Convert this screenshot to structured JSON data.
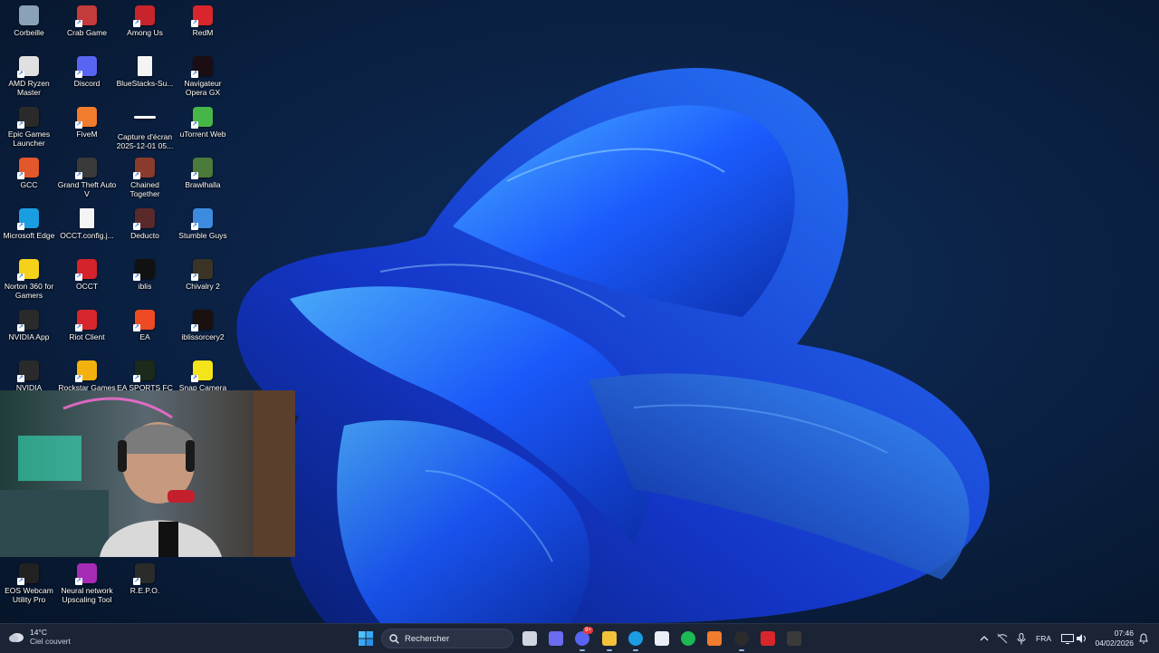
{
  "desktop": {
    "icons": [
      {
        "label": "Corbeille",
        "icon": "recycle-bin-icon",
        "color": "#8aa1b8"
      },
      {
        "label": "Crab Game",
        "icon": "crab-game-icon",
        "color": "#c43b3b"
      },
      {
        "label": "Among Us",
        "icon": "among-us-icon",
        "color": "#c8242c"
      },
      {
        "label": "RedM",
        "icon": "redm-icon",
        "color": "#d8262c"
      },
      {
        "label": "AMD Ryzen\nMaster",
        "icon": "amd-ryzen-icon",
        "color": "#e0e0e0"
      },
      {
        "label": "Discord",
        "icon": "discord-icon",
        "color": "#5865f2"
      },
      {
        "label": "BlueStacks-Su...",
        "icon": "file-icon",
        "color": "#f4f4f4"
      },
      {
        "label": "Navigateur\nOpera GX",
        "icon": "opera-gx-icon",
        "color": "#1a0d14"
      },
      {
        "label": "Epic Games\nLauncher",
        "icon": "epic-games-icon",
        "color": "#2a2a2a"
      },
      {
        "label": "FiveM",
        "icon": "fivem-icon",
        "color": "#f07c2e"
      },
      {
        "label": "Capture d'écran\n2025-12-01 05...",
        "icon": "screenshot-icon",
        "color": "#f4f4f4"
      },
      {
        "label": "uTorrent Web",
        "icon": "utorrent-icon",
        "color": "#47b649"
      },
      {
        "label": "GCC",
        "icon": "gcc-icon",
        "color": "#e2572b"
      },
      {
        "label": "Grand Theft Auto\nV",
        "icon": "gta-v-icon",
        "color": "#3a3a3a"
      },
      {
        "label": "Chained\nTogether",
        "icon": "chained-together-icon",
        "color": "#8a3b2c"
      },
      {
        "label": "Brawlhalla",
        "icon": "brawlhalla-icon",
        "color": "#4b7a3a"
      },
      {
        "label": "Microsoft Edge",
        "icon": "edge-icon",
        "color": "#1b9de2"
      },
      {
        "label": "OCCT.config.j...",
        "icon": "file-icon",
        "color": "#f4f4f4"
      },
      {
        "label": "Deducto",
        "icon": "deducto-icon",
        "color": "#5a2a2a"
      },
      {
        "label": "Stumble Guys",
        "icon": "stumble-guys-icon",
        "color": "#3d8be0"
      },
      {
        "label": "Norton 360 for\nGamers",
        "icon": "norton-icon",
        "color": "#f6d11a"
      },
      {
        "label": "OCCT",
        "icon": "occt-icon",
        "color": "#d4232b"
      },
      {
        "label": "iblis",
        "icon": "iblis-icon",
        "color": "#111111"
      },
      {
        "label": "Chivalry 2",
        "icon": "chivalry-icon",
        "color": "#3b3326"
      },
      {
        "label": "NVIDIA App",
        "icon": "nvidia-icon",
        "color": "#2a2a2a"
      },
      {
        "label": "Riot Client",
        "icon": "riot-client-icon",
        "color": "#d7262e"
      },
      {
        "label": "EA",
        "icon": "ea-icon",
        "color": "#ee4a23"
      },
      {
        "label": "iblissorcery2",
        "icon": "iblissorcery-icon",
        "color": "#1a1010"
      },
      {
        "label": "NVIDIA",
        "icon": "nvidia-icon",
        "color": "#2a2a2a"
      },
      {
        "label": "Rockstar Games",
        "icon": "rockstar-icon",
        "color": "#f2b10f"
      },
      {
        "label": "EA SPORTS FC 25",
        "icon": "ea-fc-icon",
        "color": "#1b2a1a"
      },
      {
        "label": "Snap Camera",
        "icon": "snap-camera-icon",
        "color": "#f4e41a"
      },
      {
        "label": "EOS Webcam\nUtility Pro",
        "icon": "eos-webcam-icon",
        "color": "#222222"
      },
      {
        "label": "Neural network\nUpscaling Tool",
        "icon": "neural-network-icon",
        "color": "#a62bb5"
      },
      {
        "label": "R.E.P.O.",
        "icon": "repo-icon",
        "color": "#2b2b2b"
      }
    ]
  },
  "taskbar": {
    "weather": {
      "temp": "14°C",
      "condition": "Ciel couvert",
      "icon": "cloud-icon"
    },
    "search_placeholder": "Rechercher",
    "pinned": [
      {
        "name": "task-view",
        "icon": "task-view-icon",
        "color": "#cfd6e2"
      },
      {
        "name": "copilot",
        "icon": "copilot-icon",
        "color": "#6b6cf0"
      },
      {
        "name": "discord",
        "icon": "discord-icon",
        "color": "#5865f2",
        "badge": "9+"
      },
      {
        "name": "file-explorer",
        "icon": "folder-icon",
        "color": "#f2c33a"
      },
      {
        "name": "edge",
        "icon": "edge-icon",
        "color": "#1b9de2"
      },
      {
        "name": "microsoft-store",
        "icon": "store-icon",
        "color": "#e9eef7"
      },
      {
        "name": "spotify",
        "icon": "spotify-icon",
        "color": "#1db954"
      },
      {
        "name": "fivem",
        "icon": "fivem-icon",
        "color": "#f07c2e"
      },
      {
        "name": "obs",
        "icon": "obs-icon",
        "color": "#2b2b2b"
      },
      {
        "name": "redm",
        "icon": "redm-icon",
        "color": "#d8262c"
      },
      {
        "name": "eos-webcam",
        "icon": "eos-webcam-icon",
        "color": "#3a3a3a"
      }
    ],
    "tray": {
      "language": "FRA",
      "time": "07:46",
      "date": "04/02/2026"
    }
  }
}
